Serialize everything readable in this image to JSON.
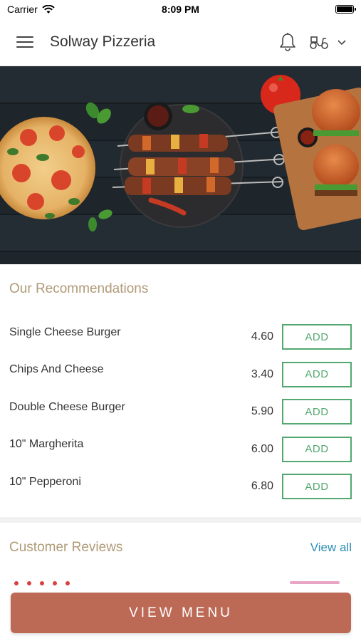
{
  "status_bar": {
    "carrier": "Carrier",
    "time": "8:09 PM"
  },
  "header": {
    "title": "Solway Pizzeria",
    "icons": [
      "menu-icon",
      "bell-icon",
      "scooter-icon",
      "chevron-down-icon"
    ]
  },
  "recommendations": {
    "title": "Our Recommendations",
    "add_label": "ADD",
    "items": [
      {
        "name": "Single Cheese Burger",
        "price": "4.60"
      },
      {
        "name": "Chips And Cheese",
        "price": "3.40"
      },
      {
        "name": "Double Cheese Burger",
        "price": "5.90"
      },
      {
        "name": "10\" Margherita",
        "price": "6.00"
      },
      {
        "name": "10\" Pepperoni",
        "price": "6.80"
      }
    ]
  },
  "reviews": {
    "title": "Customer Reviews",
    "view_all": "View all"
  },
  "cta": {
    "label": "VIEW MENU"
  },
  "colors": {
    "accent": "#bc6a56",
    "section_title": "#b09a77",
    "add_button": "#52a86f",
    "link": "#2e8fb5"
  }
}
